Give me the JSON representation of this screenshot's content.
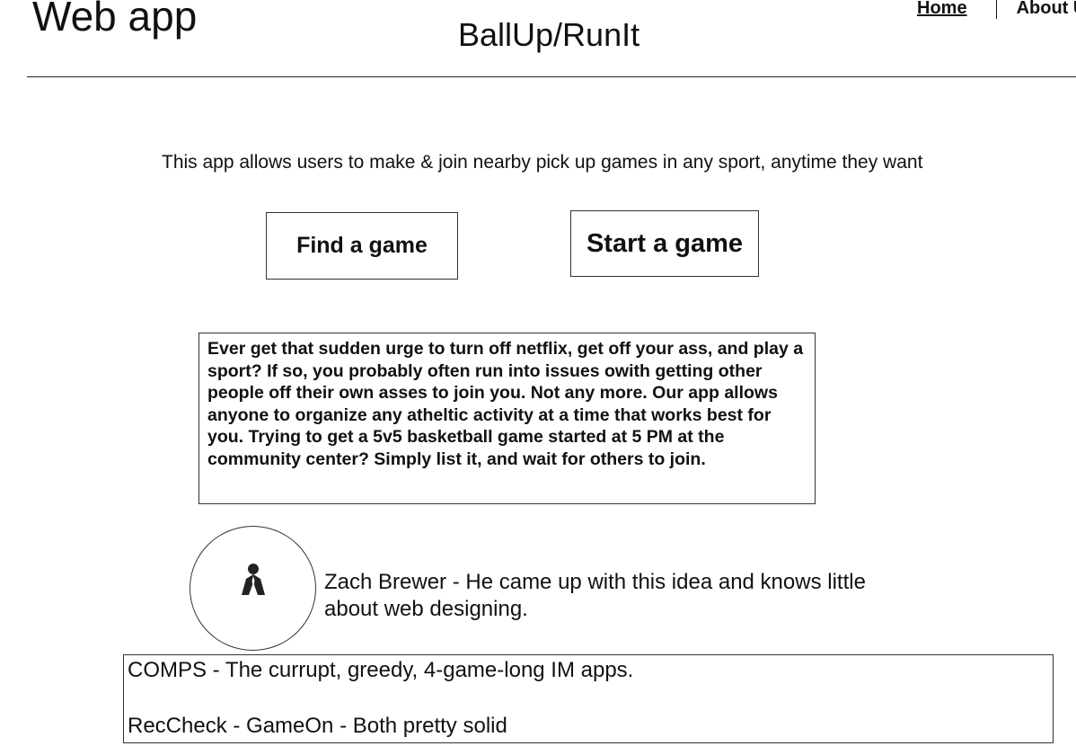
{
  "header": {
    "app_name": "Web app",
    "site_title": "BallUp/RunIt",
    "nav": {
      "home": "Home",
      "about": "About Us"
    }
  },
  "main": {
    "tagline": "This app allows users to make & join nearby pick up games in any sport, anytime they want",
    "buttons": {
      "find": "Find a game",
      "start": "Start a game"
    },
    "description": "Ever get that sudden urge to turn off netflix, get off your ass, and play a sport? If so, you probably often run into issues owith getting other people off their own asses to join you. Not any more. Our app allows anyone to organize any atheltic activity at a time that works best for you. Trying to get a 5v5 basketball game started at 5 PM at the community center? Simply list it, and wait for others to join.",
    "founder": {
      "avatar_icon": "person-icon",
      "bio": "Zach Brewer - He came up with this idea and knows little about web designing."
    },
    "comps": {
      "line1": "COMPS - The currupt, greedy, 4-game-long IM apps.",
      "line2": "RecCheck - GameOn - Both pretty solid"
    }
  }
}
